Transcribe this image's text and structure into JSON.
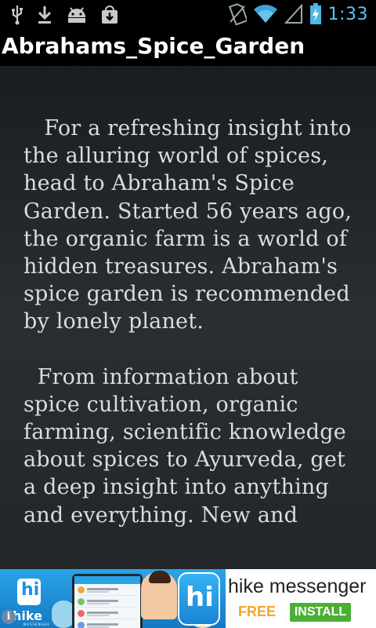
{
  "status_bar": {
    "time": "1:33",
    "left_icons": [
      "usb-icon",
      "download-icon",
      "android-icon",
      "store-download-icon"
    ],
    "right_icons": [
      "no-sim-icon",
      "wifi-icon",
      "signal-icon",
      "battery-icon"
    ]
  },
  "app": {
    "title": "Abrahams_Spice_Garden"
  },
  "article": {
    "paragraphs": [
      "For a refreshing insight into the alluring world of spices, head to Abraham's Spice Garden. Started 56 years ago, the organic farm is a world of hidden treasures. Abraham's spice garden is recommended by lonely planet.",
      "From information about spice cultivation, organic farming, scientific knowledge about spices to Ayurveda, get a deep insight into anything and everything. New and"
    ]
  },
  "ad": {
    "brand_small": "hike",
    "brand_small_sub": "MESSENGER",
    "logo_text": "hi",
    "title": "hike messenger",
    "free_label": "FREE",
    "install_label": "INSTALL",
    "info_glyph": "i"
  },
  "colors": {
    "status_icon": "#8fd3ef",
    "clock": "#5fc3ea",
    "ad_blue": "#1e90e0",
    "free": "#f6a623",
    "install": "#4caf35"
  }
}
